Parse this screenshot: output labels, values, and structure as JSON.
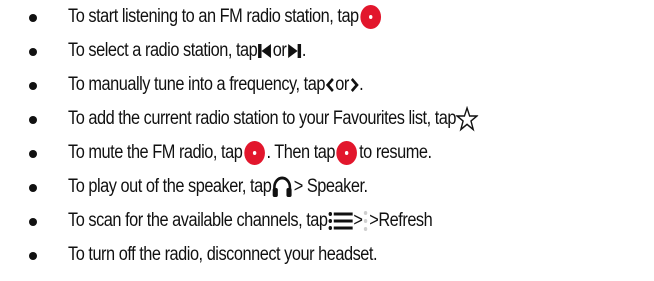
{
  "items": [
    {
      "text_a": "To start listening to an FM radio station, tap ",
      "icon": "record-icon"
    },
    {
      "text_a": "To select a radio station, tap ",
      "icon1": "skip-previous-icon",
      "text_b": " or ",
      "icon2": "skip-next-icon",
      "text_c": "."
    },
    {
      "text_a": "To manually tune into a frequency, tap ",
      "icon1": "chevron-left-icon",
      "text_b": " or ",
      "icon2": "chevron-right-icon",
      "text_c": "."
    },
    {
      "text_a": "To add the current radio station to your Favourites list, tap ",
      "icon": "star-outline-icon"
    },
    {
      "text_a": "To mute the FM radio, tap ",
      "icon1": "record-icon",
      "text_b": ". Then tap ",
      "icon2": "record-icon",
      "text_c": " to resume."
    },
    {
      "text_a": "To play out of the speaker, tap ",
      "icon": "headphones-icon",
      "text_b": "> Speaker."
    },
    {
      "text_a": "To scan for the available channels, tap ",
      "icon1": "menu-icon",
      "text_b": "> ",
      "icon2": "more-vertical-icon",
      "text_c": ">Refresh"
    },
    {
      "text_a": "To turn off the radio, disconnect your headset."
    }
  ],
  "colors": {
    "accent_red": "#e2162c",
    "text": "#111111"
  }
}
